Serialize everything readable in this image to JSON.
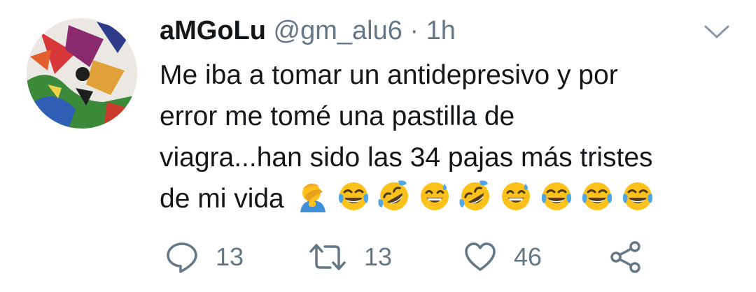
{
  "tweet": {
    "display_name": "aMGoLu",
    "handle": "@gm_alu6",
    "separator": "·",
    "time": "1h",
    "text_lines": [
      "Me iba a tomar un antidepresivo y por",
      "error me tomé una pastilla de",
      "viagra...han sido las 34 pajas más tristes",
      "de mi vida"
    ],
    "emojis": [
      "person-facepalming",
      "face-with-tears-of-joy",
      "rolling-on-the-floor-laughing",
      "grinning-face-with-sweat",
      "rolling-on-the-floor-laughing",
      "grinning-face-with-sweat",
      "face-with-tears-of-joy",
      "face-with-tears-of-joy",
      "face-with-tears-of-joy"
    ]
  },
  "actions": {
    "reply_count": "13",
    "retweet_count": "13",
    "like_count": "46"
  },
  "icons": [
    "reply-icon",
    "retweet-icon",
    "like-icon",
    "share-icon",
    "chevron-down-icon"
  ],
  "colors": {
    "text": "#14171a",
    "secondary": "#657786",
    "emoji_yellow": "#fcc21b",
    "tear_blue": "#4fa6e6"
  }
}
